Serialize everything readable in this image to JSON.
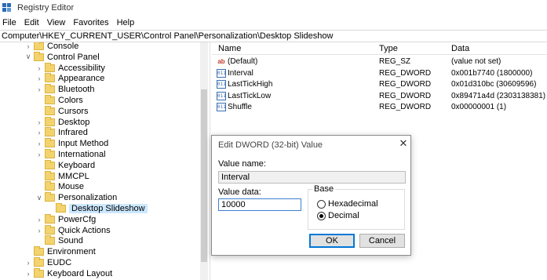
{
  "window": {
    "title": "Registry Editor"
  },
  "menu": [
    "File",
    "Edit",
    "View",
    "Favorites",
    "Help"
  ],
  "address": "Computer\\HKEY_CURRENT_USER\\Control Panel\\Personalization\\Desktop Slideshow",
  "tree": [
    {
      "label": "Console",
      "expander": ">"
    },
    {
      "label": "Control Panel",
      "expander": "v"
    },
    {
      "label": "Accessibility",
      "expander": ">"
    },
    {
      "label": "Appearance",
      "expander": ">"
    },
    {
      "label": "Bluetooth",
      "expander": ">"
    },
    {
      "label": "Colors",
      "expander": ""
    },
    {
      "label": "Cursors",
      "expander": ""
    },
    {
      "label": "Desktop",
      "expander": ">"
    },
    {
      "label": "Infrared",
      "expander": ">"
    },
    {
      "label": "Input Method",
      "expander": ">"
    },
    {
      "label": "International",
      "expander": ">"
    },
    {
      "label": "Keyboard",
      "expander": ""
    },
    {
      "label": "MMCPL",
      "expander": ""
    },
    {
      "label": "Mouse",
      "expander": ""
    },
    {
      "label": "Personalization",
      "expander": "v"
    },
    {
      "label": "Desktop Slideshow",
      "expander": "",
      "selected": true
    },
    {
      "label": "PowerCfg",
      "expander": ">"
    },
    {
      "label": "Quick Actions",
      "expander": ">"
    },
    {
      "label": "Sound",
      "expander": ""
    },
    {
      "label": "Environment",
      "expander": ""
    },
    {
      "label": "EUDC",
      "expander": ">"
    },
    {
      "label": "Keyboard Layout",
      "expander": ">"
    }
  ],
  "columns": {
    "name": "Name",
    "type": "Type",
    "data": "Data"
  },
  "values": [
    {
      "name": "(Default)",
      "type": "REG_SZ",
      "data": "(value not set)",
      "icon": "ab"
    },
    {
      "name": "Interval",
      "type": "REG_DWORD",
      "data": "0x001b7740 (1800000)",
      "icon": "011"
    },
    {
      "name": "LastTickHigh",
      "type": "REG_DWORD",
      "data": "0x01d310bc (30609596)",
      "icon": "011"
    },
    {
      "name": "LastTickLow",
      "type": "REG_DWORD",
      "data": "0x89471a4d (2303138381)",
      "icon": "011"
    },
    {
      "name": "Shuffle",
      "type": "REG_DWORD",
      "data": "0x00000001 (1)",
      "icon": "011"
    }
  ],
  "dialog": {
    "title": "Edit DWORD (32-bit) Value",
    "close": "✕",
    "value_name_label": "Value name:",
    "value_name": "Interval",
    "value_data_label": "Value data:",
    "value_data": "10000",
    "base_label": "Base",
    "hex_label": "Hexadecimal",
    "dec_label": "Decimal",
    "ok": "OK",
    "cancel": "Cancel"
  }
}
